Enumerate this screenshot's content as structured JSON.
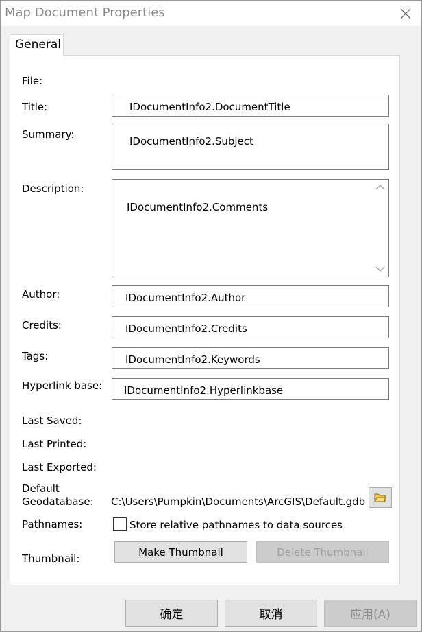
{
  "window": {
    "title": "Map Document Properties"
  },
  "tabs": [
    {
      "label": "General"
    }
  ],
  "labels": {
    "file": "File:",
    "title": "Title:",
    "summary": "Summary:",
    "description": "Description:",
    "author": "Author:",
    "credits": "Credits:",
    "tags": "Tags:",
    "hyperlink_base": "Hyperlink base:",
    "last_saved": "Last Saved:",
    "last_printed": "Last Printed:",
    "last_exported": "Last Exported:",
    "default_geodatabase_line1": "Default",
    "default_geodatabase_line2": "Geodatabase:",
    "pathnames": "Pathnames:",
    "thumbnail": "Thumbnail:"
  },
  "fields": {
    "title": "IDocumentInfo2.DocumentTitle",
    "summary": "IDocumentInfo2.Subject",
    "description": "IDocumentInfo2.Comments",
    "author": "IDocumentInfo2.Author",
    "credits": "IDocumentInfo2.Credits",
    "tags": "IDocumentInfo2.Keywords",
    "hyperlink_base": "IDocumentInfo2.Hyperlinkbase"
  },
  "default_geodatabase_path": "C:\\Users\\Pumpkin\\Documents\\ArcGIS\\Default.gdb",
  "pathnames_checkbox": {
    "label": "Store relative pathnames to data sources",
    "checked": false
  },
  "thumbnail_buttons": {
    "make": "Make Thumbnail",
    "delete": "Delete Thumbnail"
  },
  "footer": {
    "ok": "确定",
    "cancel": "取消",
    "apply": "应用(A)"
  },
  "icons": {
    "close": "close-icon",
    "folder": "folder-open-icon",
    "scroll_up": "chevron-up-icon",
    "scroll_down": "chevron-down-icon"
  }
}
